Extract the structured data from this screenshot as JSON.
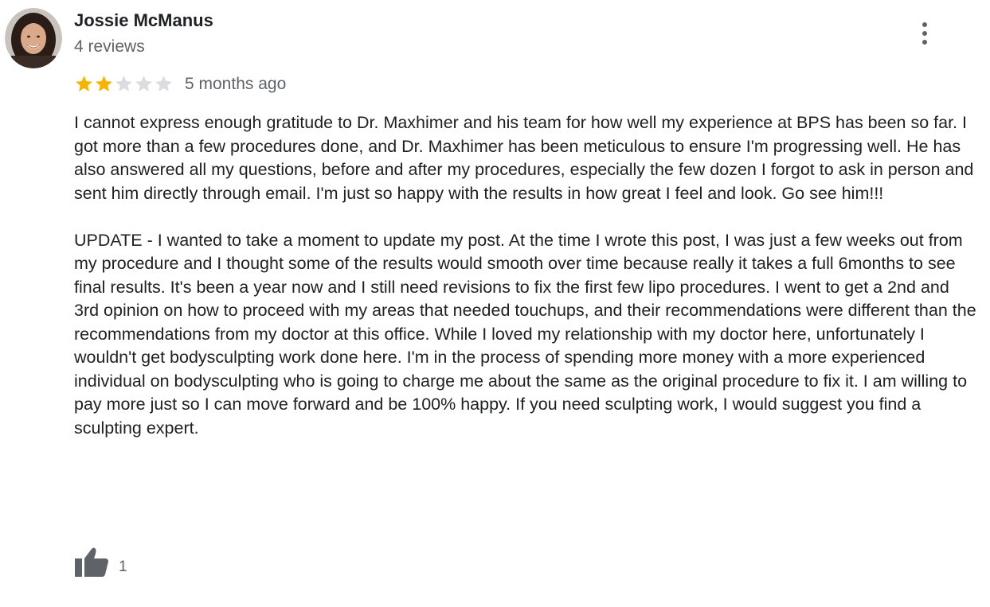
{
  "reviewer": {
    "name": "Jossie McManus",
    "review_count": "4 reviews",
    "avatar_icon": "avatar-photo"
  },
  "review": {
    "rating": 2,
    "max_rating": 5,
    "time_ago": "5 months ago",
    "paragraphs": [
      "I cannot express enough gratitude to Dr. Maxhimer and his team for how well my experience at BPS has been so far.  I got more than a few procedures done, and Dr. Maxhimer has been meticulous to ensure I'm progressing well.  He has also answered all my questions, before and after my procedures, especially the few dozen I forgot to ask in person and sent him directly through email.  I'm just so happy with the results in how great I feel and look.  Go see him!!!",
      "UPDATE - I wanted to take a moment to update my post.  At the time I wrote this post, I was just a few weeks out from my procedure and I thought some of the results would smooth over time because really it takes a full 6months to see final results.  It's been a year now and I still need revisions to fix the first few lipo procedures.  I went to get a 2nd and 3rd opinion on how to proceed with my areas that needed touchups, and their recommendations were different than the recommendations from my doctor at this office.  While I loved my relationship with my doctor here, unfortunately I wouldn't get bodysculpting work done here.  I'm in the process of spending more money with a more experienced individual on bodysculpting who is going to charge me about the same as the original procedure to fix it.  I am willing to pay more just so I can move forward and be 100% happy.  If you need sculpting work, I would suggest you find a sculpting expert."
    ],
    "likes": "1"
  },
  "colors": {
    "star_filled": "#f4b400",
    "star_empty": "#dadce0",
    "icon_gray": "#5f6368",
    "text": "#202124",
    "secondary_text": "#5f6368"
  }
}
